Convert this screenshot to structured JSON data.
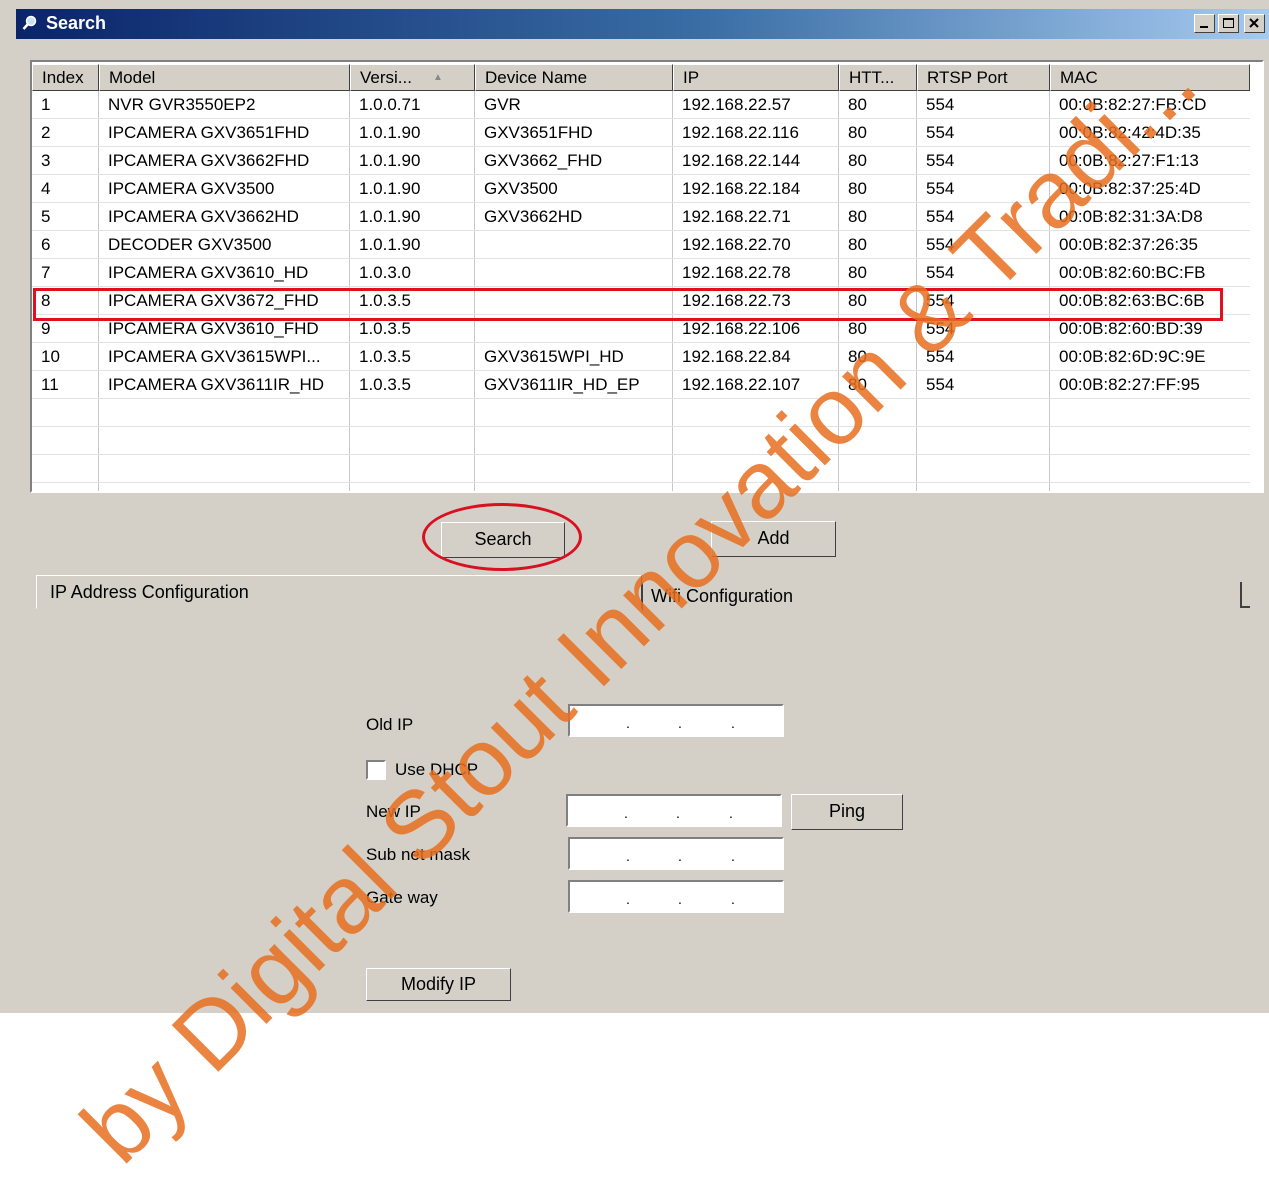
{
  "window": {
    "title": "Search"
  },
  "title_buttons": {
    "min": "_",
    "max": "□",
    "close": "×"
  },
  "grid": {
    "columns": [
      {
        "label": "Index"
      },
      {
        "label": "Model"
      },
      {
        "label": "Versi..."
      },
      {
        "label": "Device Name"
      },
      {
        "label": "IP"
      },
      {
        "label": "HTT..."
      },
      {
        "label": "RTSP Port"
      },
      {
        "label": "MAC"
      }
    ],
    "rows": [
      [
        "1",
        "NVR GVR3550EP2",
        "1.0.0.71",
        "GVR",
        "192.168.22.57",
        "80",
        "554",
        "00:0B:82:27:FB:CD"
      ],
      [
        "2",
        "IPCAMERA  GXV3651FHD",
        "1.0.1.90",
        "GXV3651FHD",
        "192.168.22.116",
        "80",
        "554",
        "00:0B:82:42:4D:35"
      ],
      [
        "3",
        "IPCAMERA GXV3662FHD",
        "1.0.1.90",
        "GXV3662_FHD",
        "192.168.22.144",
        "80",
        "554",
        "00:0B:82:27:F1:13"
      ],
      [
        "4",
        "IPCAMERA GXV3500",
        "1.0.1.90",
        "GXV3500",
        "192.168.22.184",
        "80",
        "554",
        "00:0B:82:37:25:4D"
      ],
      [
        "5",
        "IPCAMERA GXV3662HD",
        "1.0.1.90",
        "GXV3662HD",
        "192.168.22.71",
        "80",
        "554",
        "00:0B:82:31:3A:D8"
      ],
      [
        "6",
        "DECODER  GXV3500",
        "1.0.1.90",
        "",
        "192.168.22.70",
        "80",
        "554",
        "00:0B:82:37:26:35"
      ],
      [
        "7",
        "IPCAMERA GXV3610_HD",
        "1.0.3.0",
        "",
        "192.168.22.78",
        "80",
        "554",
        "00:0B:82:60:BC:FB"
      ],
      [
        "8",
        "IPCAMERA GXV3672_FHD",
        "1.0.3.5",
        "",
        "192.168.22.73",
        "80",
        "554",
        "00:0B:82:63:BC:6B"
      ],
      [
        "9",
        "IPCAMERA GXV3610_FHD",
        "1.0.3.5",
        "",
        "192.168.22.106",
        "80",
        "554",
        "00:0B:82:60:BD:39"
      ],
      [
        "10",
        "IPCAMERA GXV3615WPI...",
        "1.0.3.5",
        "GXV3615WPI_HD",
        "192.168.22.84",
        "80",
        "554",
        "00:0B:82:6D:9C:9E"
      ],
      [
        "11",
        "IPCAMERA GXV3611IR_HD",
        "1.0.3.5",
        "GXV3611IR_HD_EP",
        "192.168.22.107",
        "80",
        "554",
        "00:0B:82:27:FF:95"
      ]
    ],
    "highlighted_row_index": "8",
    "sort_indicator": "▲"
  },
  "buttons": {
    "search": "Search",
    "add": "Add",
    "ping": "Ping",
    "modify_ip": "Modify IP"
  },
  "tabs": {
    "ip_config": "IP Address Configuration",
    "wifi_config": "Wifi Configuration"
  },
  "form": {
    "old_ip_label": "Old IP",
    "use_dhcp_label": "Use DHCP",
    "new_ip_label": "New IP",
    "subnet_label": "Sub net mask",
    "gateway_label": "Gate way",
    "ip_dot": "."
  },
  "watermark": "by Digital Stout Innovation & Tradi...",
  "colors": {
    "highlight": "#e0101c",
    "circle": "#d81020",
    "watermark": "#e66e1e"
  }
}
